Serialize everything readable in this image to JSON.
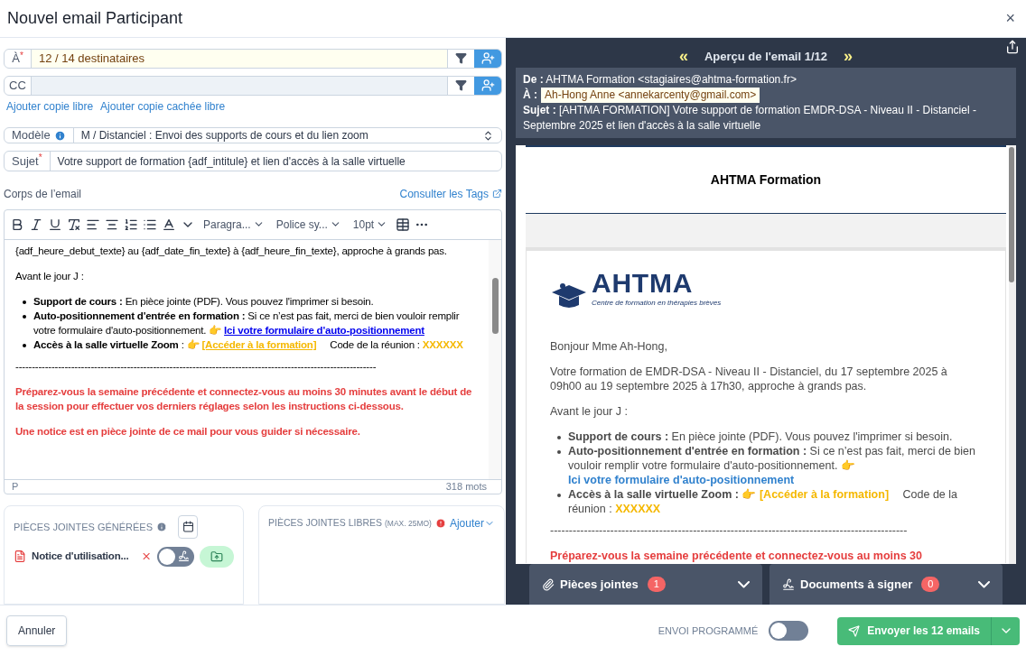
{
  "window": {
    "title": "Nouvel email Participant",
    "close": "×"
  },
  "recipients": [
    {
      "label": "À",
      "required_mark": "*",
      "highlighted": true,
      "value": "12 / 14 destinataires"
    },
    {
      "label": "CC",
      "highlighted": false
    }
  ],
  "copy_links": [
    "Ajouter copie libre",
    "Ajouter copie cachée libre"
  ],
  "template": {
    "label": "Modèle",
    "value": "M / Distanciel : Envoi des supports de cours et du lien zoom"
  },
  "subject": {
    "label": "Sujet",
    "required_mark": "*",
    "value": "Votre support de formation {adf_intitule} et lien d'accès à la salle virtuelle"
  },
  "body": {
    "label": "Corps de l’email",
    "tags_link": "Consulter les Tags",
    "dropdowns": [
      "Paragra...",
      "Police sy...",
      "10pt"
    ],
    "blocks": [
      {
        "kind": "text",
        "text": "{adf_heure_debut_texte} au {adf_date_fin_texte} à {adf_heure_fin_texte}, approche à grands pas."
      },
      {
        "kind": "text",
        "text": "Avant le jour J :"
      },
      {
        "kind": "list",
        "items": [
          {
            "label": "Support de cours :",
            "text": "En pièce jointe (PDF). Vous pouvez l'imprimer si besoin."
          },
          {
            "label": "Auto-positionnement d'entrée en formation :",
            "text": "Si ce n’est pas fait, merci de bien vouloir remplir votre formulaire d'auto-positionnement. 👉",
            "link": "Ici votre formulaire d'auto-positionnement"
          },
          {
            "label": "Accès à la salle virtuelle Zoom",
            "text": ": 👉",
            "link": "[Accéder à la formation]",
            "after": "Code de la réunion :",
            "code": "XXXXXX"
          }
        ]
      },
      {
        "kind": "rule",
        "text": "--------------------------------------------------------------------------------------------------------------"
      },
      {
        "kind": "alert",
        "text": "Préparez-vous la semaine précédente et connectez-vous au moins 30 minutes avant le début de la session pour effectuer vos derniers réglages selon les instructions ci-dessous."
      },
      {
        "kind": "alert",
        "text": "Une notice est en pièce jointe de ce mail pour vous guider si nécessaire."
      }
    ],
    "status_path": "P",
    "word_count": "318 mots"
  },
  "generated_attachments": {
    "title": "PIÈCES JOINTES GÉNÉRÉES",
    "items": [
      {
        "name": "Notice d'utilisation...",
        "sign": false
      }
    ]
  },
  "free_attachments": {
    "title": "PIÈCES JOINTES LIBRES",
    "note": "(MAX. 25MO)",
    "add": "Ajouter"
  },
  "preview": {
    "prev": "«",
    "title": "Aperçu de l'email 1/12",
    "next": "»",
    "from": {
      "label": "De :",
      "value": "AHTMA Formation <stagiaires@ahtma-formation.fr>"
    },
    "to": {
      "label": "À :",
      "value": "Ah-Hong Anne <annekarcenty@gmail.com>"
    },
    "subject": {
      "label": "Sujet :",
      "value": "[AHTMA FORMATION] Votre support de formation EMDR-DSA - Niveau II - Distanciel - Septembre 2025 et lien d'accès à la salle virtuelle"
    },
    "brand": "AHTMA Formation",
    "logo": "AHTMA",
    "tagline": "Centre de formation en thérapies brèves",
    "blocks": [
      {
        "kind": "text",
        "text": "Bonjour Mme Ah-Hong,"
      },
      {
        "kind": "text",
        "text": "Votre formation de EMDR-DSA - Niveau II - Distanciel, du 17 septembre 2025 à 09h00 au 19 septembre 2025 à 17h30, approche à grands pas."
      },
      {
        "kind": "text",
        "text": "Avant le jour J :"
      },
      {
        "kind": "list",
        "items": [
          {
            "label": "Support de cours :",
            "text": "En pièce jointe (PDF). Vous pouvez l'imprimer si besoin."
          },
          {
            "label": "Auto-positionnement d'entrée en formation :",
            "text": "Si ce n’est pas fait, merci de bien vouloir remplir votre formulaire d'auto-positionnement. 👉",
            "link": "Ici votre formulaire d'auto-positionnement"
          },
          {
            "label": "Accès à la salle virtuelle Zoom :",
            "text": "👉",
            "link": "[Accéder à la formation]",
            "after": "Code de la réunion :",
            "code": "XXXXXX"
          }
        ]
      },
      {
        "kind": "rule",
        "text": "-----------------------------------------------------------------------------------------------"
      },
      {
        "kind": "alert",
        "text": "Préparez-vous la semaine précédente et connectez-vous au moins 30"
      }
    ]
  },
  "panels": [
    {
      "kind": "attachments",
      "label": "Pièces jointes",
      "count": "1"
    },
    {
      "kind": "signatures",
      "label": "Documents à signer",
      "count": "0"
    }
  ],
  "footer": {
    "cancel": "Annuler",
    "scheduled": {
      "label": "ENVOI PROGRAMMÉ",
      "on": false
    },
    "send": "Envoyer les 12 emails"
  }
}
